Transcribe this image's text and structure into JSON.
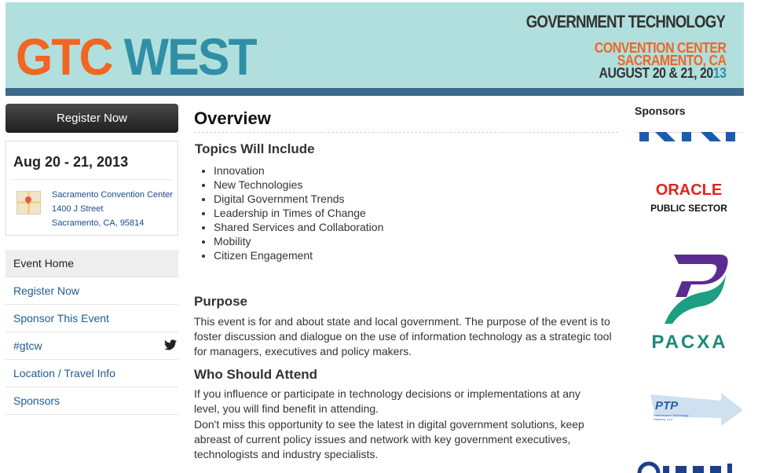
{
  "banner": {
    "logo_part1": "GTC",
    "logo_part2": " WEST",
    "brand": "GOVERNMENT TECHNOLOGY",
    "venue_line1": "CONVENTION CENTER",
    "venue_line2": "SACRAMENTO, CA",
    "dates_prefix": "AUGUST 20 & 21, 20",
    "dates_suffix": "13",
    "colors": {
      "bg": "#b0dfdd",
      "stripe": "#3b6a8e",
      "orange": "#f26522",
      "teal": "#2f8fa6"
    }
  },
  "sidebar": {
    "register_label": "Register Now",
    "date_range": "Aug 20 - 21, 2013",
    "address": {
      "venue": "Sacramento Convention Center",
      "street": "1400 J Street",
      "city": "Sacramento, CA, 95814"
    },
    "nav": [
      {
        "label": "Event Home",
        "active": true
      },
      {
        "label": "Register Now"
      },
      {
        "label": "Sponsor This Event"
      },
      {
        "label": "#gtcw",
        "icon": "twitter-icon"
      },
      {
        "label": "Location / Travel Info"
      },
      {
        "label": "Sponsors"
      }
    ]
  },
  "main": {
    "title": "Overview",
    "topics_title": "Topics Will Include",
    "topics": [
      "Innovation",
      "New Technologies",
      "Digital Government Trends",
      "Leadership in Times of Change",
      "Shared Services and Collaboration",
      "Mobility",
      "Citizen Engagement"
    ],
    "purpose_title": "Purpose",
    "purpose_text": "This event is for and about state and local government. The purpose of the event is to foster discussion and dialogue on the use of information technology as a strategic tool for managers, executives and policy makers.",
    "attend_title": "Who Should Attend",
    "attend_text1": "If you influence or participate in technology decisions or implementations at any level, you will find benefit in attending.",
    "attend_text2": "Don't miss this opportunity to see the latest in digital government solutions, keep abreast of current policy issues and network with key government executives, technologists and industry specialists."
  },
  "sponsors": {
    "title": "Sponsors",
    "oracle_line1": "ORACLE",
    "oracle_line2": "PUBLIC SECTOR",
    "pacxa": "PACXA",
    "ptp": "PTP",
    "ptp_sub": "Performance Technology Partners, LLC"
  }
}
